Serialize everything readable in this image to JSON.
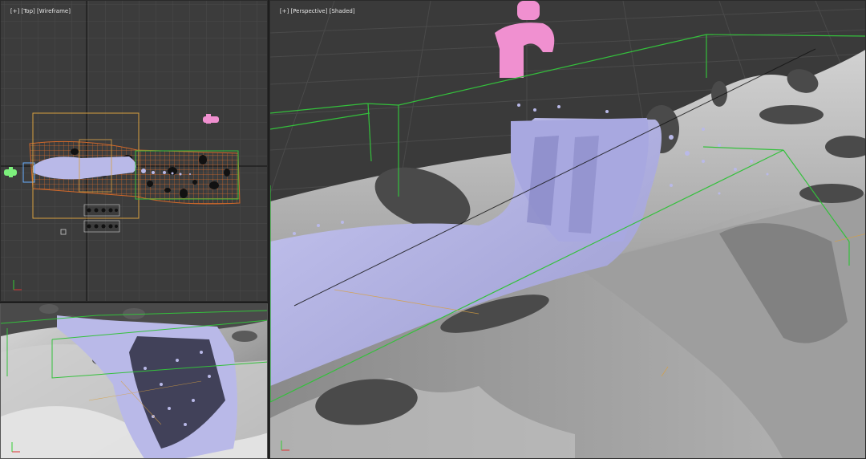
{
  "viewports": {
    "top": {
      "labels": [
        "[+]",
        "[Top]",
        "[Wireframe]"
      ]
    },
    "perspective": {
      "labels": [
        "[+]",
        "[Perspective]",
        "[Shaded]"
      ]
    }
  },
  "colors": {
    "grid_bg": "#3c3c3c",
    "fluid": "#b9b9e8",
    "emitter": "#f090d0",
    "bounds": "#34c03c",
    "selection": "#d8a040",
    "terrain": "#a8a8a8"
  }
}
